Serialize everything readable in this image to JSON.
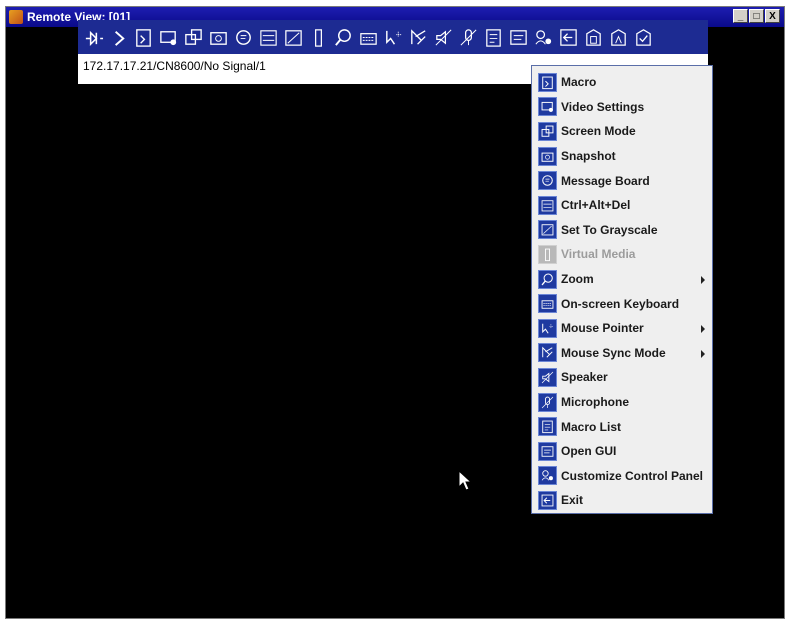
{
  "window": {
    "title": "Remote View: [01]",
    "buttons": [
      "_",
      "□",
      "X"
    ]
  },
  "toolbar": {
    "icons": [
      "pin-icon",
      "expand-arrow-icon",
      "macro-icon",
      "video-settings-icon",
      "screen-mode-icon",
      "snapshot-icon",
      "message-board-icon",
      "ctrl-alt-del-icon",
      "grayscale-icon",
      "virtual-media-icon",
      "zoom-icon",
      "keyboard-icon",
      "mouse-pointer-icon",
      "mouse-sync-icon",
      "speaker-icon",
      "microphone-icon",
      "macro-list-icon",
      "open-gui-icon",
      "customize-panel-icon",
      "exit-icon",
      "num-lock-icon",
      "caps-lock-icon",
      "scroll-lock-icon"
    ]
  },
  "address": {
    "text": "172.17.17.21/CN8600/No Signal/1"
  },
  "menu": {
    "items": [
      {
        "label": "Macro",
        "icon": "macro-icon",
        "enabled": true,
        "submenu": false
      },
      {
        "label": "Video Settings",
        "icon": "video-settings-icon",
        "enabled": true,
        "submenu": false
      },
      {
        "label": "Screen Mode",
        "icon": "screen-mode-icon",
        "enabled": true,
        "submenu": false
      },
      {
        "label": "Snapshot",
        "icon": "snapshot-icon",
        "enabled": true,
        "submenu": false
      },
      {
        "label": "Message Board",
        "icon": "message-board-icon",
        "enabled": true,
        "submenu": false
      },
      {
        "label": "Ctrl+Alt+Del",
        "icon": "ctrl-alt-del-icon",
        "enabled": true,
        "submenu": false
      },
      {
        "label": "Set To Grayscale",
        "icon": "grayscale-icon",
        "enabled": true,
        "submenu": false
      },
      {
        "label": "Virtual Media",
        "icon": "virtual-media-icon",
        "enabled": false,
        "submenu": false
      },
      {
        "label": "Zoom",
        "icon": "zoom-icon",
        "enabled": true,
        "submenu": true
      },
      {
        "label": "On-screen Keyboard",
        "icon": "keyboard-icon",
        "enabled": true,
        "submenu": false
      },
      {
        "label": "Mouse Pointer",
        "icon": "mouse-pointer-icon",
        "enabled": true,
        "submenu": true
      },
      {
        "label": "Mouse Sync Mode",
        "icon": "mouse-sync-icon",
        "enabled": true,
        "submenu": true
      },
      {
        "label": "Speaker",
        "icon": "speaker-icon",
        "enabled": true,
        "submenu": false
      },
      {
        "label": "Microphone",
        "icon": "microphone-icon",
        "enabled": true,
        "submenu": false
      },
      {
        "label": "Macro List",
        "icon": "macro-list-icon",
        "enabled": true,
        "submenu": false
      },
      {
        "label": "Open GUI",
        "icon": "open-gui-icon",
        "enabled": true,
        "submenu": false
      },
      {
        "label": "Customize Control Panel",
        "icon": "customize-panel-icon",
        "enabled": true,
        "submenu": false
      },
      {
        "label": "Exit",
        "icon": "exit-icon",
        "enabled": true,
        "submenu": false
      }
    ]
  },
  "colors": {
    "toolbar_bg": "#1d2b92",
    "icon_bg": "#1f3aa0",
    "menu_bg": "#efefef",
    "screen_bg": "#000000"
  }
}
